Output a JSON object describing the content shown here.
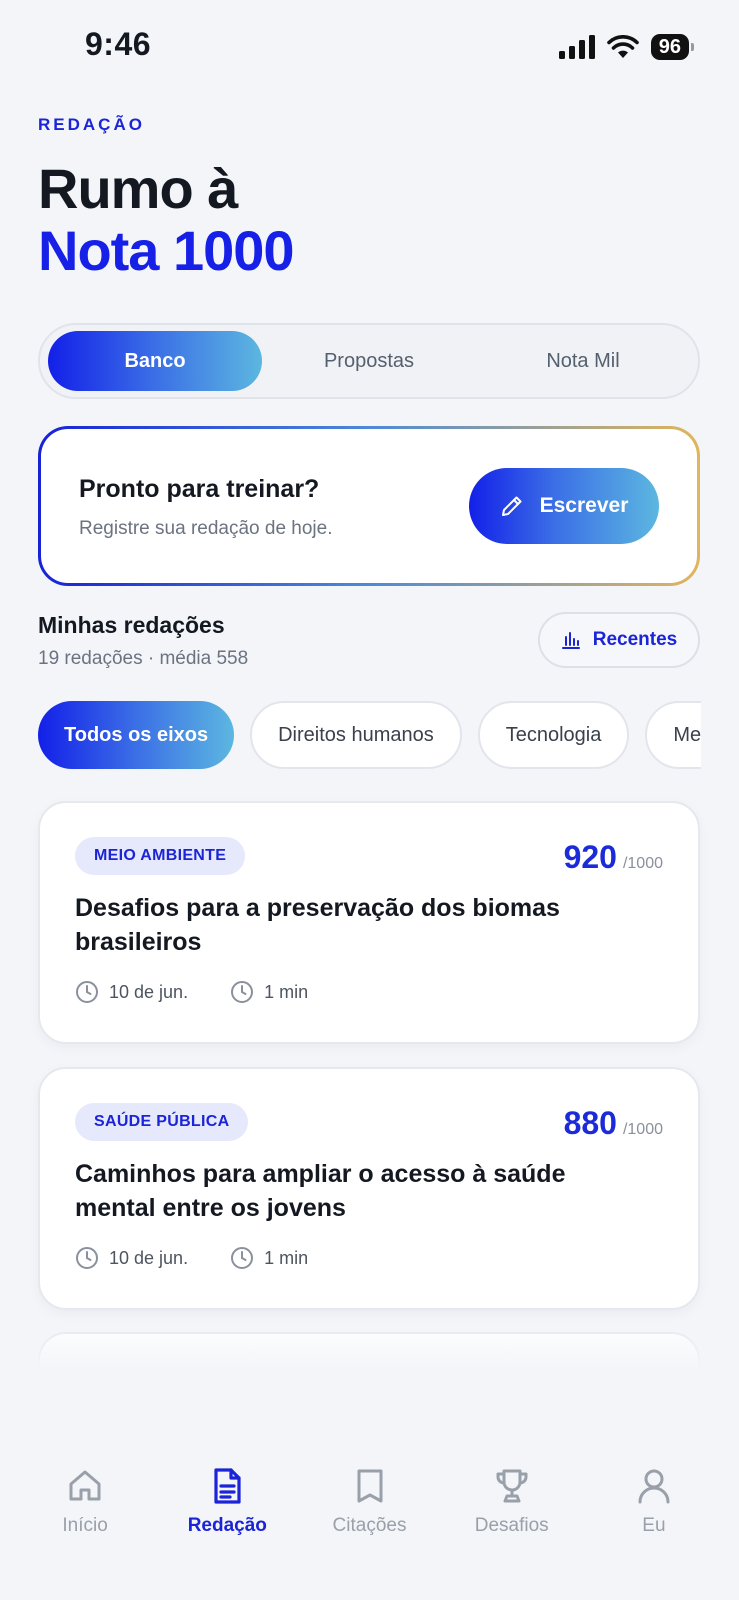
{
  "status": {
    "time": "9:46",
    "battery": "96"
  },
  "header": {
    "eyebrow": "REDAÇÃO",
    "title_line1": "Rumo à",
    "title_line2": "Nota 1000"
  },
  "segments": [
    {
      "label": "Banco",
      "active": true
    },
    {
      "label": "Propostas",
      "active": false
    },
    {
      "label": "Nota Mil",
      "active": false
    }
  ],
  "cta": {
    "title": "Pronto para treinar?",
    "subtitle": "Registre sua redação de hoje.",
    "button": "Escrever"
  },
  "section": {
    "title": "Minhas redações",
    "meta": "19 redações · média 558",
    "sort_label": "Recentes"
  },
  "chips": [
    "Todos os eixos",
    "Direitos humanos",
    "Tecnologia",
    "Meio ambiente"
  ],
  "essays": [
    {
      "tag": "MEIO AMBIENTE",
      "score": "920",
      "max": "/1000",
      "title": "Desafios para a preservação dos biomas brasileiros",
      "date": "10 de jun.",
      "duration": "1 min"
    },
    {
      "tag": "SAÚDE PÚBLICA",
      "score": "880",
      "max": "/1000",
      "title": "Caminhos para ampliar o acesso à saúde mental entre os jovens",
      "date": "10 de jun.",
      "duration": "1 min"
    }
  ],
  "tabs": [
    {
      "label": "Início",
      "icon": "home-icon"
    },
    {
      "label": "Redação",
      "icon": "document-icon",
      "active": true
    },
    {
      "label": "Citações",
      "icon": "bookmark-icon"
    },
    {
      "label": "Desafios",
      "icon": "trophy-icon"
    },
    {
      "label": "Eu",
      "icon": "person-icon"
    }
  ],
  "colors": {
    "accent": "#1b24d6",
    "gradient_start": "#1320e8",
    "gradient_end": "#5cb7e0",
    "gold": "#e2b55a"
  }
}
